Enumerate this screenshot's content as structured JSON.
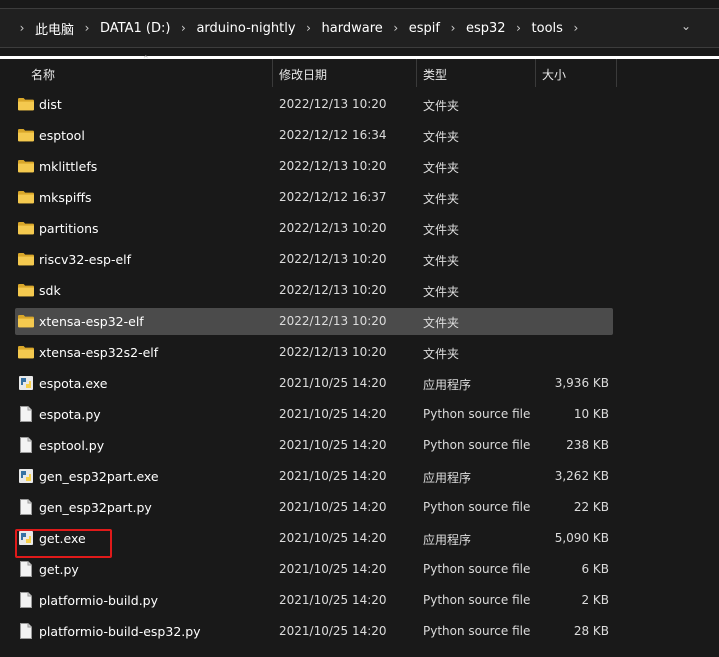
{
  "breadcrumb": [
    "此电脑",
    "DATA1 (D:)",
    "arduino-nightly",
    "hardware",
    "espif",
    "esp32",
    "tools"
  ],
  "columns": {
    "name": "名称",
    "modified": "修改日期",
    "type": "类型",
    "size": "大小"
  },
  "files": [
    {
      "name": "dist",
      "modified": "2022/12/13 10:20",
      "type": "文件夹",
      "size": "",
      "icon": "folder-icon"
    },
    {
      "name": "esptool",
      "modified": "2022/12/12 16:34",
      "type": "文件夹",
      "size": "",
      "icon": "folder-icon"
    },
    {
      "name": "mklittlefs",
      "modified": "2022/12/13 10:20",
      "type": "文件夹",
      "size": "",
      "icon": "folder-icon"
    },
    {
      "name": "mkspiffs",
      "modified": "2022/12/12 16:37",
      "type": "文件夹",
      "size": "",
      "icon": "folder-icon"
    },
    {
      "name": "partitions",
      "modified": "2022/12/13 10:20",
      "type": "文件夹",
      "size": "",
      "icon": "folder-icon"
    },
    {
      "name": "riscv32-esp-elf",
      "modified": "2022/12/13 10:20",
      "type": "文件夹",
      "size": "",
      "icon": "folder-icon"
    },
    {
      "name": "sdk",
      "modified": "2022/12/13 10:20",
      "type": "文件夹",
      "size": "",
      "icon": "folder-icon"
    },
    {
      "name": "xtensa-esp32-elf",
      "modified": "2022/12/13 10:20",
      "type": "文件夹",
      "size": "",
      "icon": "folder-icon",
      "selected": true
    },
    {
      "name": "xtensa-esp32s2-elf",
      "modified": "2022/12/13 10:20",
      "type": "文件夹",
      "size": "",
      "icon": "folder-icon"
    },
    {
      "name": "espota.exe",
      "modified": "2021/10/25 14:20",
      "type": "应用程序",
      "size": "3,936 KB",
      "icon": "python-exe-icon"
    },
    {
      "name": "espota.py",
      "modified": "2021/10/25 14:20",
      "type": "Python source file",
      "size": "10 KB",
      "icon": "file-icon"
    },
    {
      "name": "esptool.py",
      "modified": "2021/10/25 14:20",
      "type": "Python source file",
      "size": "238 KB",
      "icon": "file-icon"
    },
    {
      "name": "gen_esp32part.exe",
      "modified": "2021/10/25 14:20",
      "type": "应用程序",
      "size": "3,262 KB",
      "icon": "python-exe-icon"
    },
    {
      "name": "gen_esp32part.py",
      "modified": "2021/10/25 14:20",
      "type": "Python source file",
      "size": "22 KB",
      "icon": "file-icon"
    },
    {
      "name": "get.exe",
      "modified": "2021/10/25 14:20",
      "type": "应用程序",
      "size": "5,090 KB",
      "icon": "python-exe-icon",
      "highlighted": true
    },
    {
      "name": "get.py",
      "modified": "2021/10/25 14:20",
      "type": "Python source file",
      "size": "6 KB",
      "icon": "file-icon"
    },
    {
      "name": "platformio-build.py",
      "modified": "2021/10/25 14:20",
      "type": "Python source file",
      "size": "2 KB",
      "icon": "file-icon"
    },
    {
      "name": "platformio-build-esp32.py",
      "modified": "2021/10/25 14:20",
      "type": "Python source file",
      "size": "28 KB",
      "icon": "file-icon"
    }
  ],
  "colors": {
    "highlight": "#e01a1a",
    "folder": "#f4c94f",
    "selected_row": "#4b4b4b"
  }
}
